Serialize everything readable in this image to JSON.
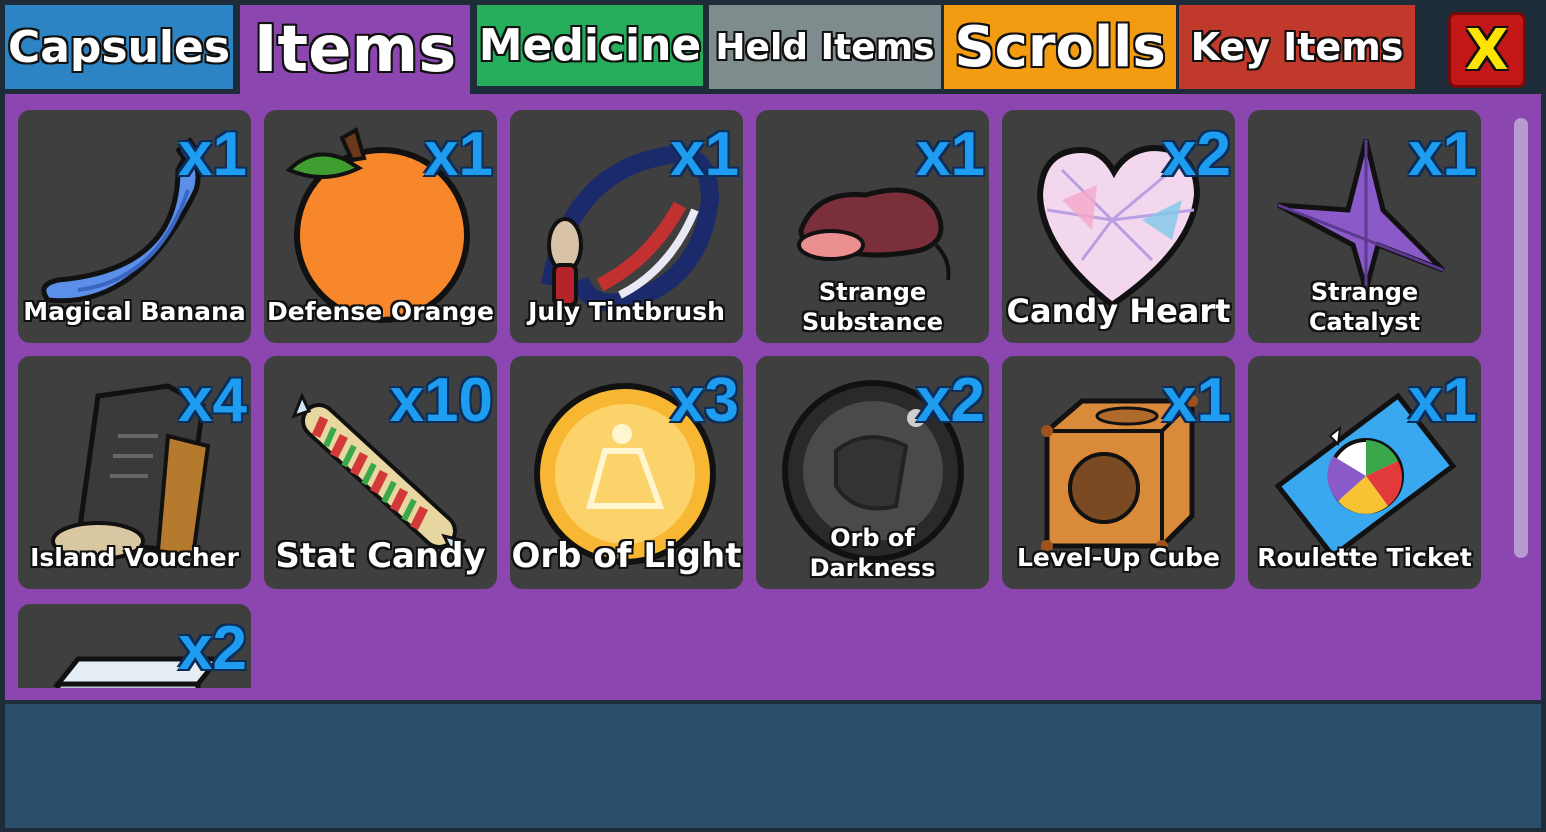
{
  "tabs": [
    {
      "label": "Capsules",
      "color": "#2c84c4",
      "active": false
    },
    {
      "label": "Items",
      "color": "#8c46b0",
      "active": true
    },
    {
      "label": "Medicine",
      "color": "#27ae5c",
      "active": false
    },
    {
      "label": "Held Items",
      "color": "#7f8c8d",
      "active": false
    },
    {
      "label": "Scrolls",
      "color": "#f39c12",
      "active": false
    },
    {
      "label": "Key Items",
      "color": "#c0392b",
      "active": false
    }
  ],
  "close": {
    "label": "X"
  },
  "items": [
    {
      "name": "Magical Banana",
      "qty": "x1",
      "icon": "banana-icon"
    },
    {
      "name": "Defense Orange",
      "qty": "x1",
      "icon": "orange-icon"
    },
    {
      "name": "July Tintbrush",
      "qty": "x1",
      "icon": "paintbrush-icon"
    },
    {
      "name": "Strange Substance",
      "qty": "x1",
      "icon": "substance-icon"
    },
    {
      "name": "Candy Heart",
      "qty": "x2",
      "icon": "heart-icon"
    },
    {
      "name": "Strange Catalyst",
      "qty": "x1",
      "icon": "catalyst-icon"
    },
    {
      "name": "Island Voucher",
      "qty": "x4",
      "icon": "voucher-icon"
    },
    {
      "name": "Stat Candy",
      "qty": "x10",
      "icon": "candy-icon"
    },
    {
      "name": "Orb of Light",
      "qty": "x3",
      "icon": "light-orb-icon"
    },
    {
      "name": "Orb of Darkness",
      "qty": "x2",
      "icon": "dark-orb-icon"
    },
    {
      "name": "Level-Up Cube",
      "qty": "x1",
      "icon": "cube-icon"
    },
    {
      "name": "Roulette Ticket",
      "qty": "x1",
      "icon": "ticket-icon"
    },
    {
      "name": "",
      "qty": "x2",
      "icon": "bar-icon"
    }
  ],
  "colors": {
    "panel": "#8c46b0",
    "card": "#3f3f3f",
    "quantity": "#1e9cf0",
    "footer": "#2a4f6b"
  }
}
